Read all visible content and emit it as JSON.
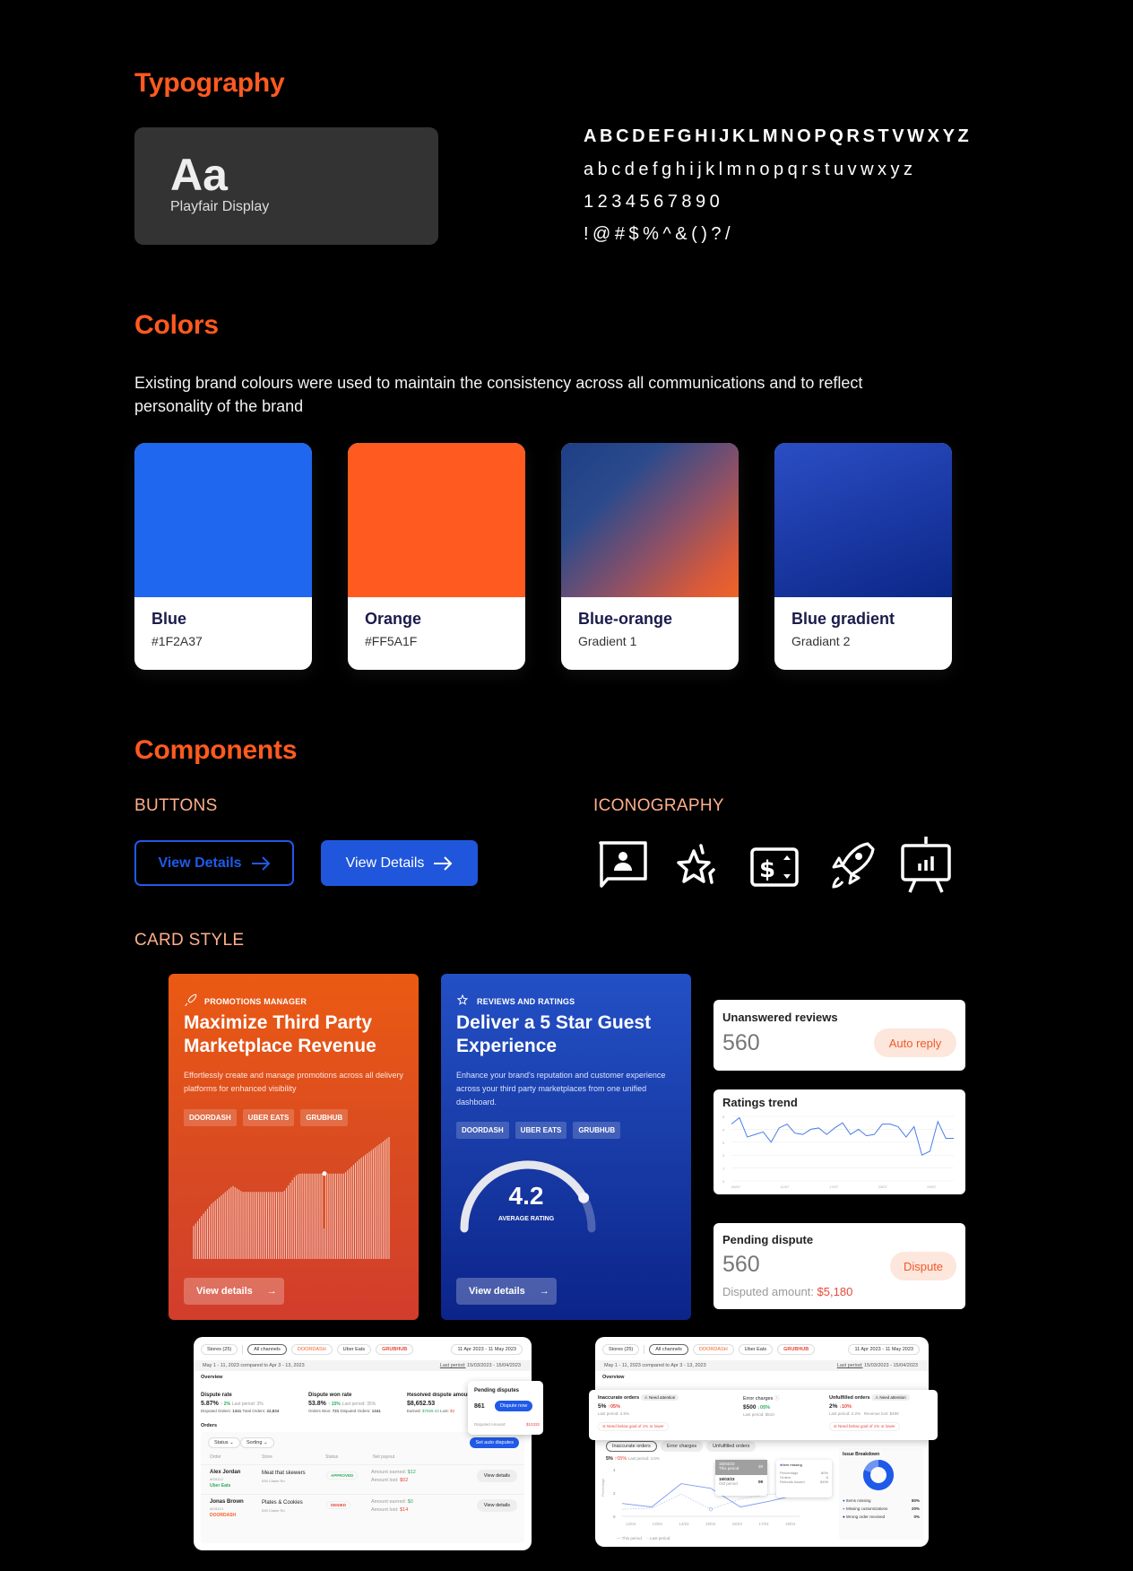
{
  "typography": {
    "heading": "Typography",
    "sample": "Aa",
    "font_name": "Playfair Display",
    "uppercase": "ABCDEFGHIJKLMNOPQRSTVWXYZ",
    "lowercase": "abcdefghijklmnopqrstuvwxyz",
    "digits": "1234567890",
    "symbols": "!@#$%^&()?/"
  },
  "colors": {
    "heading": "Colors",
    "description": "Existing brand colours were used to maintain the consistency across all communications and to reflect personality of the brand",
    "swatches": [
      {
        "name": "Blue",
        "value": "#1F2A37",
        "display": "#1F67EE"
      },
      {
        "name": "Orange",
        "value": "#FF5A1F",
        "display": "#FF5A1F"
      },
      {
        "name": "Blue-orange",
        "value": "Gradient 1"
      },
      {
        "name": "Blue gradient",
        "value": "Gradiant 2"
      }
    ]
  },
  "components": {
    "heading": "Components",
    "buttons_heading": "BUTTONS",
    "iconography_heading": "ICONOGRAPHY",
    "card_style_heading": "CARD STYLE",
    "button_outline_label": "View Details",
    "button_solid_label": "View Details",
    "icons": [
      "review-chat-icon",
      "sparkle-star-icon",
      "dollar-price-icon",
      "rocket-icon",
      "presentation-chart-icon"
    ]
  },
  "promo_card": {
    "kicker": "PROMOTIONS MANAGER",
    "title": "Maximize Third Party Marketplace Revenue",
    "description": "Effortlessly create and manage promotions across all delivery platforms for enhanced visibility",
    "chips": [
      "DOORDASH",
      "UBER EATS",
      "GRUBHUB"
    ],
    "button": "View details"
  },
  "reviews_card": {
    "kicker": "REVIEWS AND RATINGS",
    "title": "Deliver a 5 Star Guest Experience",
    "description": "Enhance your brand's reputation and customer experience across your third party marketplaces from one unified dashboard.",
    "chips": [
      "DOORDASH",
      "UBER EATS",
      "GRUBHUB"
    ],
    "rating": "4.2",
    "rating_label": "AVERAGE RATING",
    "rating_value": 4.2,
    "rating_max": 5,
    "button": "View details"
  },
  "unanswered": {
    "title": "Unanswered reviews",
    "value": "560",
    "button": "Auto reply"
  },
  "ratings_trend": {
    "title": "Ratings trend",
    "y_ticks": [
      "0",
      "1",
      "2",
      "3",
      "4",
      "5"
    ],
    "x_ticks": [
      "05/07",
      "11/07",
      "17/07",
      "23/07",
      "29/07"
    ],
    "values": [
      4.4,
      4.9,
      3.4,
      3.6,
      3.8,
      3.0,
      4.1,
      4.4,
      3.7,
      3.6,
      4.0,
      4.1,
      3.6,
      4.1,
      4.5,
      3.6,
      4.0,
      3.5,
      3.6,
      4.4,
      4.4,
      4.2,
      3.4,
      4.2,
      2.0,
      2.3,
      4.6,
      3.3,
      3.3
    ]
  },
  "pending": {
    "title": "Pending dispute",
    "value": "560",
    "button": "Dispute",
    "amount_label": "Disputed amount:",
    "amount": "$5,180"
  },
  "dash_left": {
    "stores": "Stores (25)",
    "channels": [
      "All channels",
      "DOORDASH",
      "Uber Eats",
      "GRUBHUB"
    ],
    "date_range": "11 Apr 2023 - 11 May 2023",
    "compare": "May 1 - 11, 2023 compared to Apr 3 - 13, 2023",
    "last_period_label": "Last period:",
    "last_period": "15/03/2023 - 15/04/2023",
    "overview": "Overview",
    "metrics": [
      {
        "title": "Dispute rate",
        "value": "5.87%",
        "delta": "2%",
        "last": "Last period: 3%",
        "sub1_label": "Disputed Orders:",
        "sub1": "1341",
        "sub2_label": "Total Orders:",
        "sub2": "22,834"
      },
      {
        "title": "Dispute won rate",
        "value": "53.8%",
        "delta": "15%",
        "last": "Last period: 35%",
        "sub1_label": "Orders Won:",
        "sub1": "721",
        "sub2_label": "Disputed Orders:",
        "sub2": "1341"
      },
      {
        "title": "Resolved dispute amount",
        "value": "$8,652.53",
        "earned_label": "Earned:",
        "earned": "$7659.43",
        "lost_label": "Lost:",
        "lost": "$2"
      }
    ],
    "popup": {
      "title": "Pending disputes",
      "count": "861",
      "button": "Dispute now",
      "amount_label": "Disputed Amount:",
      "amount": "$10332"
    },
    "orders_label": "Orders",
    "filters": [
      "Status",
      "Sorting"
    ],
    "auto_button": "Set auto disputes",
    "columns": [
      "Order",
      "Store",
      "Status",
      "Net payout"
    ],
    "rows": [
      {
        "name": "Alex Jordan",
        "id": "#031112",
        "channel": "Uber Eats",
        "store": "Meat that skewers",
        "address": "535 Clarke Rd",
        "status": "APPROVED",
        "earned": "$12",
        "lost": "$02",
        "action": "View details"
      },
      {
        "name": "Jonas Brown",
        "id": "#031113",
        "channel": "DOORDASH",
        "store": "Plates & Cookies",
        "address": "535 Clarke Rd",
        "status": "DENIED",
        "earned": "$0",
        "lost": "$14",
        "action": "View details"
      }
    ],
    "earned_label": "Amount earned:",
    "lost_label": "Amount lost:"
  },
  "dash_right": {
    "stores": "Stores (25)",
    "channels": [
      "All channels",
      "DOORDASH",
      "Uber Eats",
      "GRUBHUB"
    ],
    "date_range": "11 Apr 2023 - 11 May 2023",
    "compare": "May 1 - 11, 2023 compared to Apr 3 - 13, 2023",
    "last_period_label": "Last period:",
    "last_period": "15/03/2023 - 15/04/2023",
    "overview": "Overview",
    "metrics": [
      {
        "title": "Inaccurate orders",
        "badge": "Need attention",
        "value": "5%",
        "delta": "05%",
        "last": "Last period: 4.5%",
        "goal": "Need below goal of 1% or lower"
      },
      {
        "title": "Error charges",
        "value": "$500",
        "delta": "05%",
        "last": "Last period: $510"
      },
      {
        "title": "Unfulfilled orders",
        "badge": "Need attention",
        "value": "2%",
        "delta": "10%",
        "last": "Last period: 2.2%",
        "extra": "Revenue lost: $499",
        "goal": "Need below goal of 1% or lower"
      }
    ],
    "tabs": [
      "Inaccurate orders",
      "Error charges",
      "Unfulfilled orders"
    ],
    "chart_summary": {
      "value": "5%",
      "delta": "05%",
      "last": "Last period: 4.5%"
    },
    "y_label": "Percentage",
    "y_ticks": [
      "0",
      "2",
      "4"
    ],
    "x_ticks": [
      "12/04",
      "13/04",
      "14/04",
      "15/04",
      "16/04",
      "17/04",
      "18/04"
    ],
    "this_period": [
      1.1,
      0.8,
      2.8,
      2.4,
      0.8,
      1.3,
      1.9
    ],
    "last_period_values": [
      0.6,
      0.7,
      1.9,
      0.6,
      1.5,
      1.9,
      2.0
    ],
    "legend": [
      "This period",
      "Last period"
    ],
    "tooltip": {
      "date1": "15/04/23",
      "label1": "This period",
      "val1": "20",
      "date2": "15/03/23",
      "label2": "Old period",
      "val2": "09"
    },
    "item_tip": {
      "title": "Item missing",
      "rows": [
        [
          "Percentage",
          "80%"
        ],
        [
          "Orders",
          "6"
        ],
        [
          "Refunds issued",
          "$499"
        ]
      ]
    },
    "breakdown_title": "Issue Breakdown",
    "breakdown": [
      {
        "label": "Items missing",
        "value": "80%",
        "color": "#1f5ae8"
      },
      {
        "label": "Missing customizations",
        "value": "20%",
        "color": "#6f95f2"
      },
      {
        "label": "Wrong order received",
        "value": "0%",
        "color": "#2a2a4a"
      }
    ]
  }
}
